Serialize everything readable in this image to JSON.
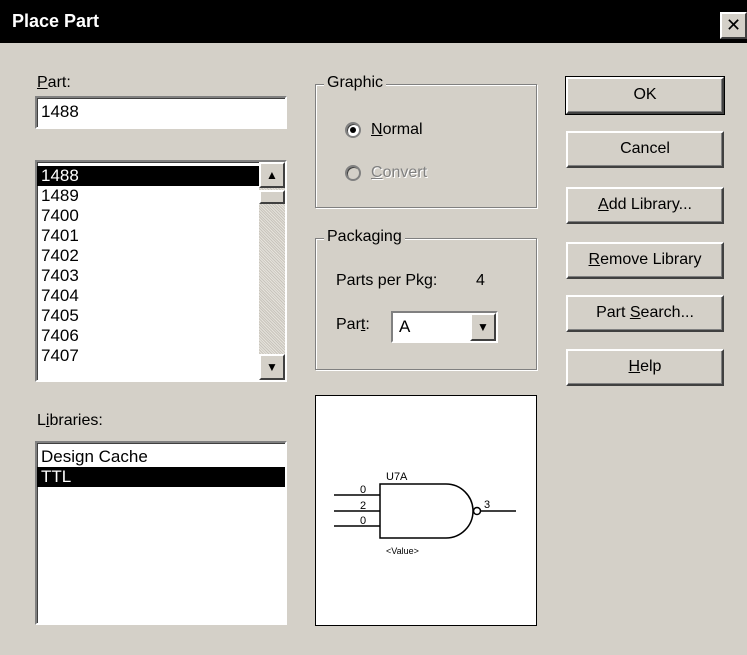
{
  "window": {
    "title": "Place Part",
    "close_glyph": "✕"
  },
  "part": {
    "label_accel": "P",
    "label_rest": "art:",
    "value": "1488",
    "items": [
      "1488",
      "1489",
      "7400",
      "7401",
      "7402",
      "7403",
      "7404",
      "7405",
      "7406",
      "7407"
    ],
    "selected_index": 0
  },
  "libraries": {
    "label_pre": "L",
    "label_accel": "i",
    "label_rest": "braries:",
    "items": [
      "Design Cache",
      "TTL"
    ],
    "selected_index": 1
  },
  "graphic": {
    "title": "Graphic",
    "normal": {
      "accel": "N",
      "rest": "ormal",
      "checked": true
    },
    "convert": {
      "accel": "C",
      "rest": "onvert",
      "enabled": false
    }
  },
  "packaging": {
    "title": "Packaging",
    "parts_per_pkg_label": "Parts per Pkg:",
    "parts_per_pkg_value": "4",
    "part_label_pre": "Par",
    "part_label_accel": "t",
    "part_label_rest": ":",
    "part_value": "A"
  },
  "buttons": {
    "ok": "OK",
    "cancel": "Cancel",
    "add_library": {
      "accel": "A",
      "rest": "dd Library..."
    },
    "remove_library": {
      "accel": "R",
      "rest": "emove Library"
    },
    "part_search": {
      "pre": "Part ",
      "accel": "S",
      "rest": "earch..."
    },
    "help": {
      "accel": "H",
      "rest": "elp"
    }
  },
  "preview": {
    "ref": "U7A",
    "pin_in1": "0",
    "pin_in2": "2",
    "pin_in3": "0",
    "pin_out": "3",
    "value_text": "<Value>"
  },
  "colors": {
    "face": "#d4d0c8",
    "titlebar": "#000000",
    "selection": "#000000"
  }
}
